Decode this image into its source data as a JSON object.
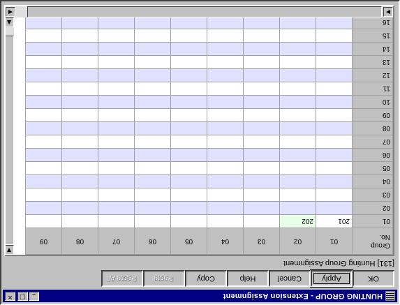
{
  "window": {
    "title": "HUNTING GROUP - Extension Assignment",
    "minimize_glyph": "_",
    "maximize_glyph": "□",
    "close_glyph": "✕"
  },
  "buttons": [
    {
      "label": "OK",
      "enabled": true
    },
    {
      "label": "Apply",
      "enabled": true
    },
    {
      "label": "Cancel",
      "enabled": true
    },
    {
      "label": "Help",
      "enabled": true
    },
    {
      "label": "Copy",
      "enabled": true
    },
    {
      "label": "Paste",
      "enabled": false
    },
    {
      "label": "Paste All",
      "enabled": false
    }
  ],
  "caption": "[131] Hunting Group Assignment",
  "grid": {
    "corner_label_1": "Group",
    "corner_label_2": "No.",
    "columns": [
      "01",
      "02",
      "03",
      "04",
      "05",
      "06",
      "07",
      "08",
      "09"
    ],
    "rows": [
      {
        "label": "01",
        "cells": [
          "201",
          "202",
          "",
          "",
          "",
          "",
          "",
          "",
          ""
        ]
      },
      {
        "label": "02",
        "cells": [
          "",
          "",
          "",
          "",
          "",
          "",
          "",
          "",
          ""
        ]
      },
      {
        "label": "03",
        "cells": [
          "",
          "",
          "",
          "",
          "",
          "",
          "",
          "",
          ""
        ]
      },
      {
        "label": "04",
        "cells": [
          "",
          "",
          "",
          "",
          "",
          "",
          "",
          "",
          ""
        ]
      },
      {
        "label": "05",
        "cells": [
          "",
          "",
          "",
          "",
          "",
          "",
          "",
          "",
          ""
        ]
      },
      {
        "label": "06",
        "cells": [
          "",
          "",
          "",
          "",
          "",
          "",
          "",
          "",
          ""
        ]
      },
      {
        "label": "07",
        "cells": [
          "",
          "",
          "",
          "",
          "",
          "",
          "",
          "",
          ""
        ]
      },
      {
        "label": "08",
        "cells": [
          "",
          "",
          "",
          "",
          "",
          "",
          "",
          "",
          ""
        ]
      },
      {
        "label": "09",
        "cells": [
          "",
          "",
          "",
          "",
          "",
          "",
          "",
          "",
          ""
        ]
      },
      {
        "label": "10",
        "cells": [
          "",
          "",
          "",
          "",
          "",
          "",
          "",
          "",
          ""
        ]
      },
      {
        "label": "11",
        "cells": [
          "",
          "",
          "",
          "",
          "",
          "",
          "",
          "",
          ""
        ]
      },
      {
        "label": "12",
        "cells": [
          "",
          "",
          "",
          "",
          "",
          "",
          "",
          "",
          ""
        ]
      },
      {
        "label": "13",
        "cells": [
          "",
          "",
          "",
          "",
          "",
          "",
          "",
          "",
          ""
        ]
      },
      {
        "label": "14",
        "cells": [
          "",
          "",
          "",
          "",
          "",
          "",
          "",
          "",
          ""
        ]
      },
      {
        "label": "15",
        "cells": [
          "",
          "",
          "",
          "",
          "",
          "",
          "",
          "",
          ""
        ]
      },
      {
        "label": "16",
        "cells": [
          "",
          "",
          "",
          "",
          "",
          "",
          "",
          "",
          ""
        ]
      }
    ]
  },
  "scroll": {
    "up_glyph": "▲",
    "down_glyph": "▼",
    "left_glyph": "◀",
    "right_glyph": "▶"
  },
  "colors": {
    "titlebar": "#000080",
    "row_tint": "#e0e0ff",
    "selected_cell": "#e8ffe8"
  }
}
